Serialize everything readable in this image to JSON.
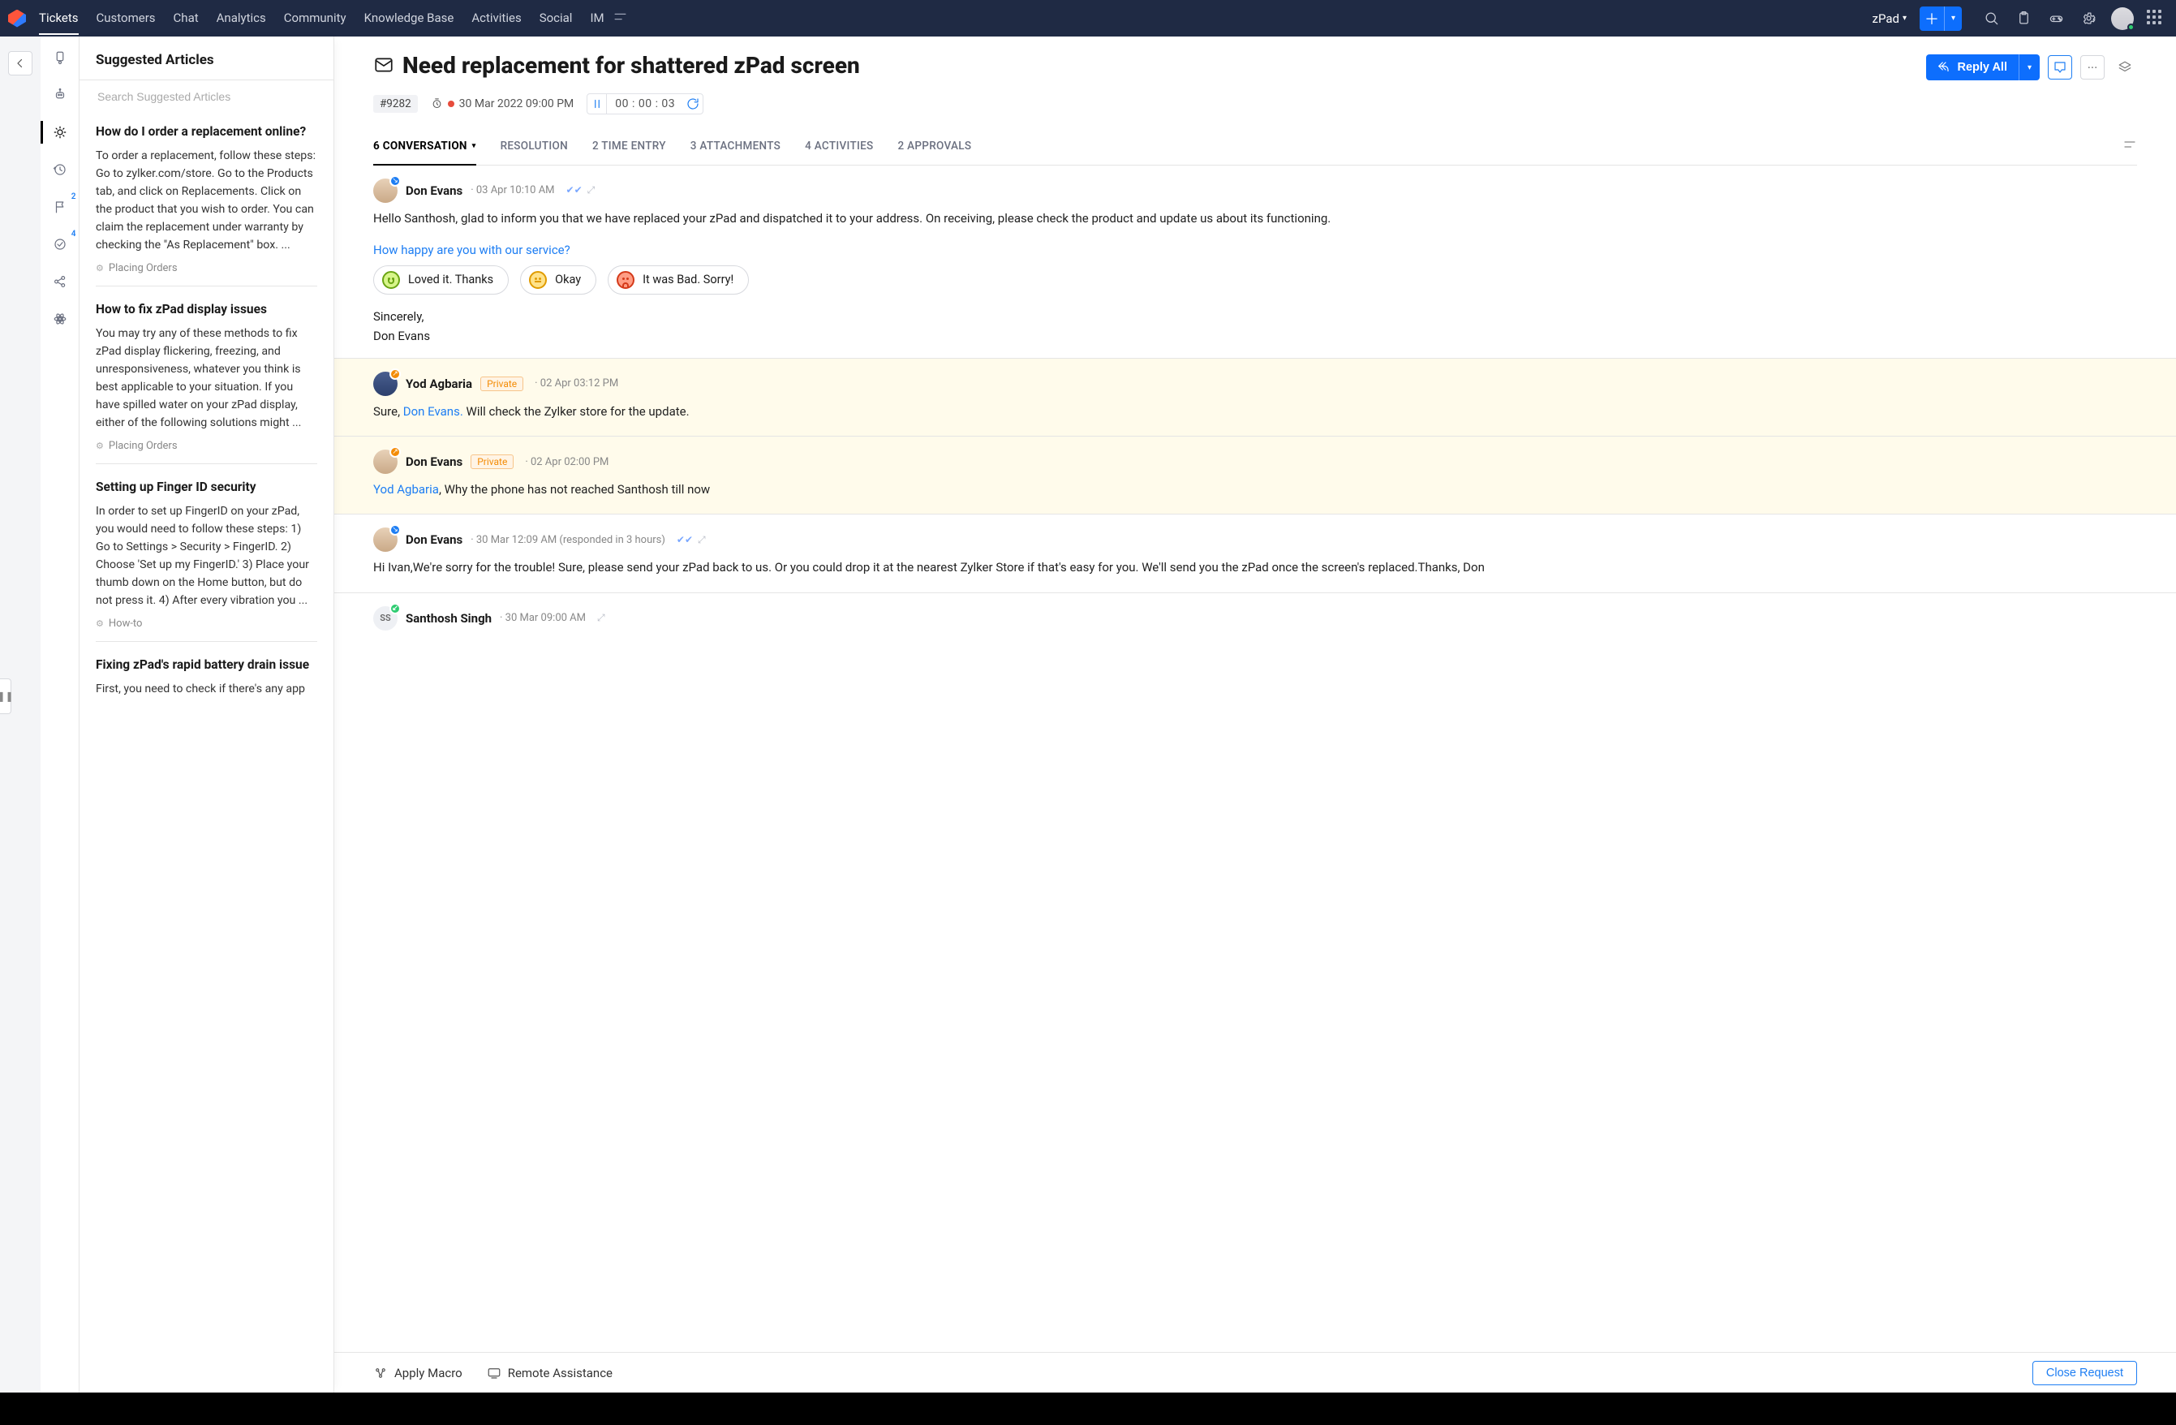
{
  "nav": {
    "items": [
      "Tickets",
      "Customers",
      "Chat",
      "Analytics",
      "Community",
      "Knowledge Base",
      "Activities",
      "Social",
      "IM"
    ],
    "active_index": 0,
    "department": "zPad"
  },
  "rail": {
    "flag_badge": "2",
    "approval_badge": "4"
  },
  "articles": {
    "header": "Suggested Articles",
    "search_placeholder": "Search Suggested Articles",
    "items": [
      {
        "title": "How do I order a replacement online?",
        "body": "To order a replacement, follow these steps: Go to zylker.com/store. Go to the Products tab, and click on Replacements. Click on the product that you wish to order.  You can claim the replacement under warranty by checking the \"As Replacement\" box. ...",
        "category": "Placing Orders"
      },
      {
        "title": "How to fix zPad display issues",
        "body": "You may try any of these methods to fix zPad display flickering, freezing, and unresponsiveness, whatever you think is best applicable to your situation. If you have spilled water on your zPad display, either of the following solutions might ...",
        "category": "Placing Orders"
      },
      {
        "title": "Setting up Finger ID security",
        "body": "In order to set up FingerID on your zPad, you would need to follow these steps: 1) Go to Settings > Security > FingerID. 2) Choose 'Set up my FingerID.' 3) Place your thumb down on the Home button, but do not press it. 4) After every vibration you ...",
        "category": "How-to"
      },
      {
        "title": "Fixing zPad's rapid battery drain issue",
        "body": "First, you need to check if there's any app",
        "category": ""
      }
    ]
  },
  "ticket": {
    "title": "Need replacement for shattered zPad screen",
    "id": "#9282",
    "overdue_label": "30 Mar 2022 09:00 PM",
    "timer": "00 : 00 : 03",
    "reply_label": "Reply All",
    "close_label": "Close Request",
    "apply_macro": "Apply Macro",
    "remote_assist": "Remote Assistance",
    "subtabs": [
      {
        "label": "6 CONVERSATION",
        "active": true,
        "caret": true
      },
      {
        "label": "RESOLUTION"
      },
      {
        "label": "2 TIME ENTRY"
      },
      {
        "label": "3 ATTACHMENTS"
      },
      {
        "label": "4 ACTIVITIES"
      },
      {
        "label": "2 APPROVALS"
      }
    ],
    "feedback_q": "How happy are you with our service?",
    "fb_loved": "Loved it. Thanks",
    "fb_okay": "Okay",
    "fb_bad": "It was Bad. Sorry!",
    "signoff": "Sincerely,",
    "signname": "Don Evans"
  },
  "conversation": [
    {
      "sender": "Don Evans",
      "ts": "03 Apr 10:10 AM",
      "avatar": "don",
      "corner": "in",
      "private": false,
      "show_checks": true,
      "text": "Hello Santhosh, glad to inform you that we have replaced your zPad and dispatched it to your address. On receiving, please check the product and update us about its functioning.",
      "has_feedback": true
    },
    {
      "sender": "Yod Agbaria",
      "ts": "02 Apr 03:12 PM",
      "avatar": "blue",
      "corner": "out",
      "private": true,
      "text_prefix": "Sure, ",
      "mention": "Don Evans.",
      "text_suffix": " Will check the Zylker store for the update."
    },
    {
      "sender": "Don Evans",
      "ts": "02 Apr 02:00 PM",
      "avatar": "don",
      "corner": "out",
      "private": true,
      "mention_first": "Yod Agbaria",
      "text_after": ",  Why the phone has not reached Santhosh till now"
    },
    {
      "sender": "Don Evans",
      "ts": "30 Mar 12:09 AM (responded in 3 hours)",
      "avatar": "don",
      "corner": "in",
      "private": false,
      "show_checks": true,
      "text": "Hi Ivan,We're sorry for the trouble! Sure, please send your zPad back to us. Or you could drop it at the nearest Zylker Store if that's easy for you. We'll send you the zPad once the screen's replaced.Thanks, Don"
    },
    {
      "sender": "Santhosh Singh",
      "ts": "30 Mar 09:00 AM",
      "avatar": "initials",
      "initials": "SS",
      "corner": "g",
      "private": false,
      "cutoff": true
    }
  ]
}
